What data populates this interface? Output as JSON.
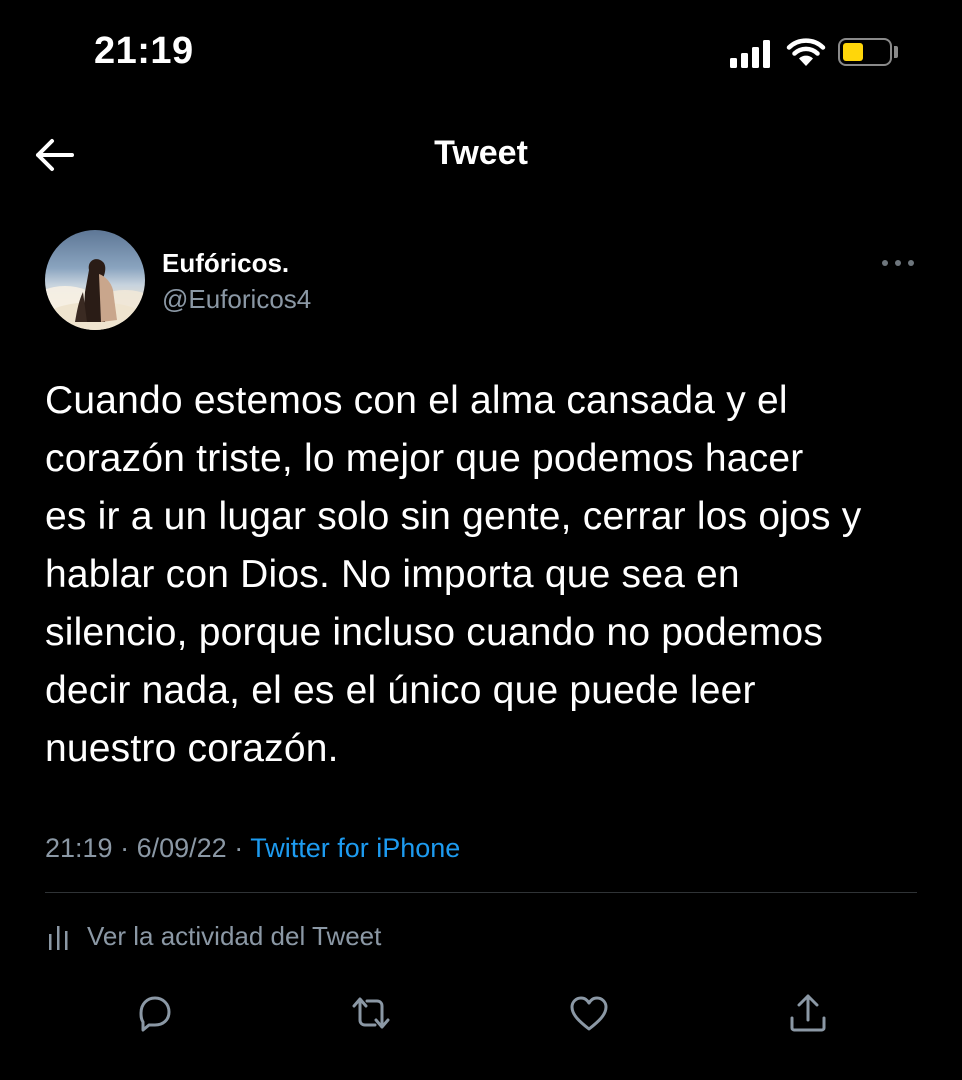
{
  "status_bar": {
    "time": "21:19"
  },
  "header": {
    "title": "Tweet"
  },
  "author": {
    "display_name": "Eufóricos.",
    "handle": "@Euforicos4"
  },
  "tweet": {
    "lines": [
      "Cuando estemos con el alma cansada y el",
      "corazón triste, lo mejor que podemos hacer",
      "es ir a un lugar solo sin gente, cerrar los ojos y",
      "hablar con Dios. No importa que sea en",
      "silencio, porque incluso cuando no podemos",
      "decir nada, el es el único que puede leer",
      "nuestro corazón."
    ],
    "time": "21:19",
    "separator": "·",
    "date": "6/09/22",
    "source": "Twitter for iPhone"
  },
  "activity": {
    "label": "Ver la actividad del Tweet"
  },
  "actions": {
    "icons": [
      "reply-icon",
      "retweet-icon",
      "like-icon",
      "share-icon"
    ]
  },
  "colors": {
    "background": "#000000",
    "text": "#ffffff",
    "secondary": "#8b98a5",
    "link": "#1d9bf0",
    "battery": "#ffd60a"
  }
}
